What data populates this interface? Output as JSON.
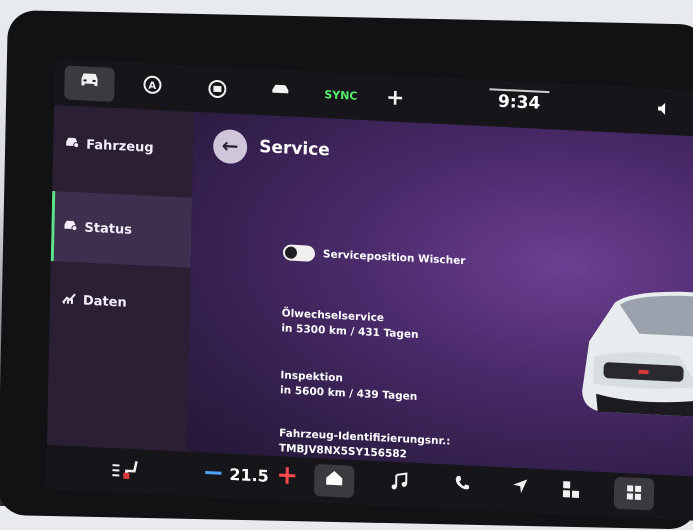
{
  "topbar": {
    "icons": [
      "car-icon",
      "auto-hold-off-icon",
      "driver-assist-icon",
      "vehicle-settings-icon",
      "sync-icon",
      "plus-icon"
    ],
    "sync_label": "SYNC",
    "time": "9:34"
  },
  "sidebar": {
    "items": [
      {
        "label": "Fahrzeug",
        "icon": "car-gear-icon",
        "active": false
      },
      {
        "label": "Status",
        "icon": "car-gear-icon",
        "active": true
      },
      {
        "label": "Daten",
        "icon": "chart-icon",
        "active": false
      }
    ]
  },
  "main": {
    "title": "Service",
    "toggle": {
      "label": "Serviceposition Wischer",
      "on": false
    },
    "oil_service": {
      "label": "Ölwechselservice",
      "value": "in 5300 km / 431 Tagen"
    },
    "inspection": {
      "label": "Inspektion",
      "value": "in 5600 km / 439 Tagen"
    },
    "vin": {
      "label": "Fahrzeug-Identifizierungsnr.:",
      "value": "TMBJV8NX5SY156582"
    }
  },
  "bottombar": {
    "temperature": "21.5",
    "minus": "−",
    "plus": "+",
    "icons": [
      "seat-heating-icon",
      "home-icon",
      "music-icon",
      "phone-icon",
      "navigation-icon",
      "apps-icon",
      "grid-icon"
    ]
  },
  "colors": {
    "accent_green": "#5fe38a",
    "sync_green": "#54f06b",
    "temp_minus_blue": "#4da3ff",
    "temp_plus_red": "#ff4b4b",
    "background_purple": "#4a2a6a"
  }
}
